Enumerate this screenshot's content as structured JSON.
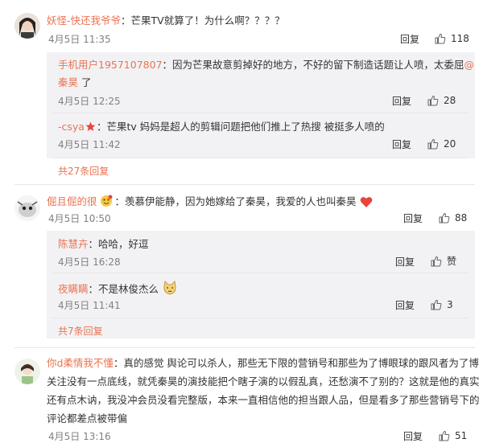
{
  "comments": [
    {
      "user": "妖怪-快还我爷爷",
      "text": "：芒果TV就算了！为什么啊？？？？",
      "time": "4月5日 11:35",
      "reply": "回复",
      "likes": "118",
      "subs": [
        {
          "user": "手机用户1957107807",
          "text": "：因为芒果故意剪掉好的地方，不好的留下制造话题让人喷，太委屈",
          "mention": "@",
          "mention2": "秦昊",
          "text2": " 了",
          "time": "4月5日 12:25",
          "reply": "回复",
          "likes": "28"
        },
        {
          "user": "-csya",
          "text": "：芒果tv 妈妈是超人的剪辑问题把他们推上了热搜   被挺多人喷的",
          "time": "4月5日 11:42",
          "reply": "回复",
          "likes": "20"
        }
      ],
      "more": "共27条回复"
    },
    {
      "user": "倔且倔的很",
      "text": "：羡慕伊能静，因为她嫁给了秦昊，我爱的人也叫秦昊",
      "time": "4月5日 10:50",
      "reply": "回复",
      "likes": "88",
      "subs": [
        {
          "user": "陈慧卉",
          "text": "：哈哈，好逗",
          "time": "4月5日 16:28",
          "reply": "回复",
          "likes": "赞"
        },
        {
          "user": "夜瞒瞒",
          "text": "：不是林俊杰么",
          "time": "4月5日 11:41",
          "reply": "回复",
          "likes": "3"
        }
      ],
      "more": "共7条回复"
    },
    {
      "user": "你d柔情我不懂",
      "lines": [
        "：真的感觉 舆论可以杀人，那些无下限的营销号和那些为了博眼球的跟风者为了博",
        "关注没有一点底线，就凭秦昊的演技能把个瞎子演的以假乱真，还愁演不了别的？这就是他的真实",
        "还有点木讷，我没冲会员没看完整版，本来一直相信他的担当跟人品，但是看多了那些营销号下的",
        "评论都差点被带偏"
      ],
      "time": "4月5日 13:16",
      "reply": "回复",
      "likes": "51"
    }
  ],
  "colors": {
    "username": "#eb7350",
    "subbox": "#f2f2f5",
    "meta": "#808080",
    "heart": "#e8453c"
  },
  "icons": [
    "thumb-up-icon",
    "star-icon",
    "heart-icon",
    "emoji-icon"
  ]
}
